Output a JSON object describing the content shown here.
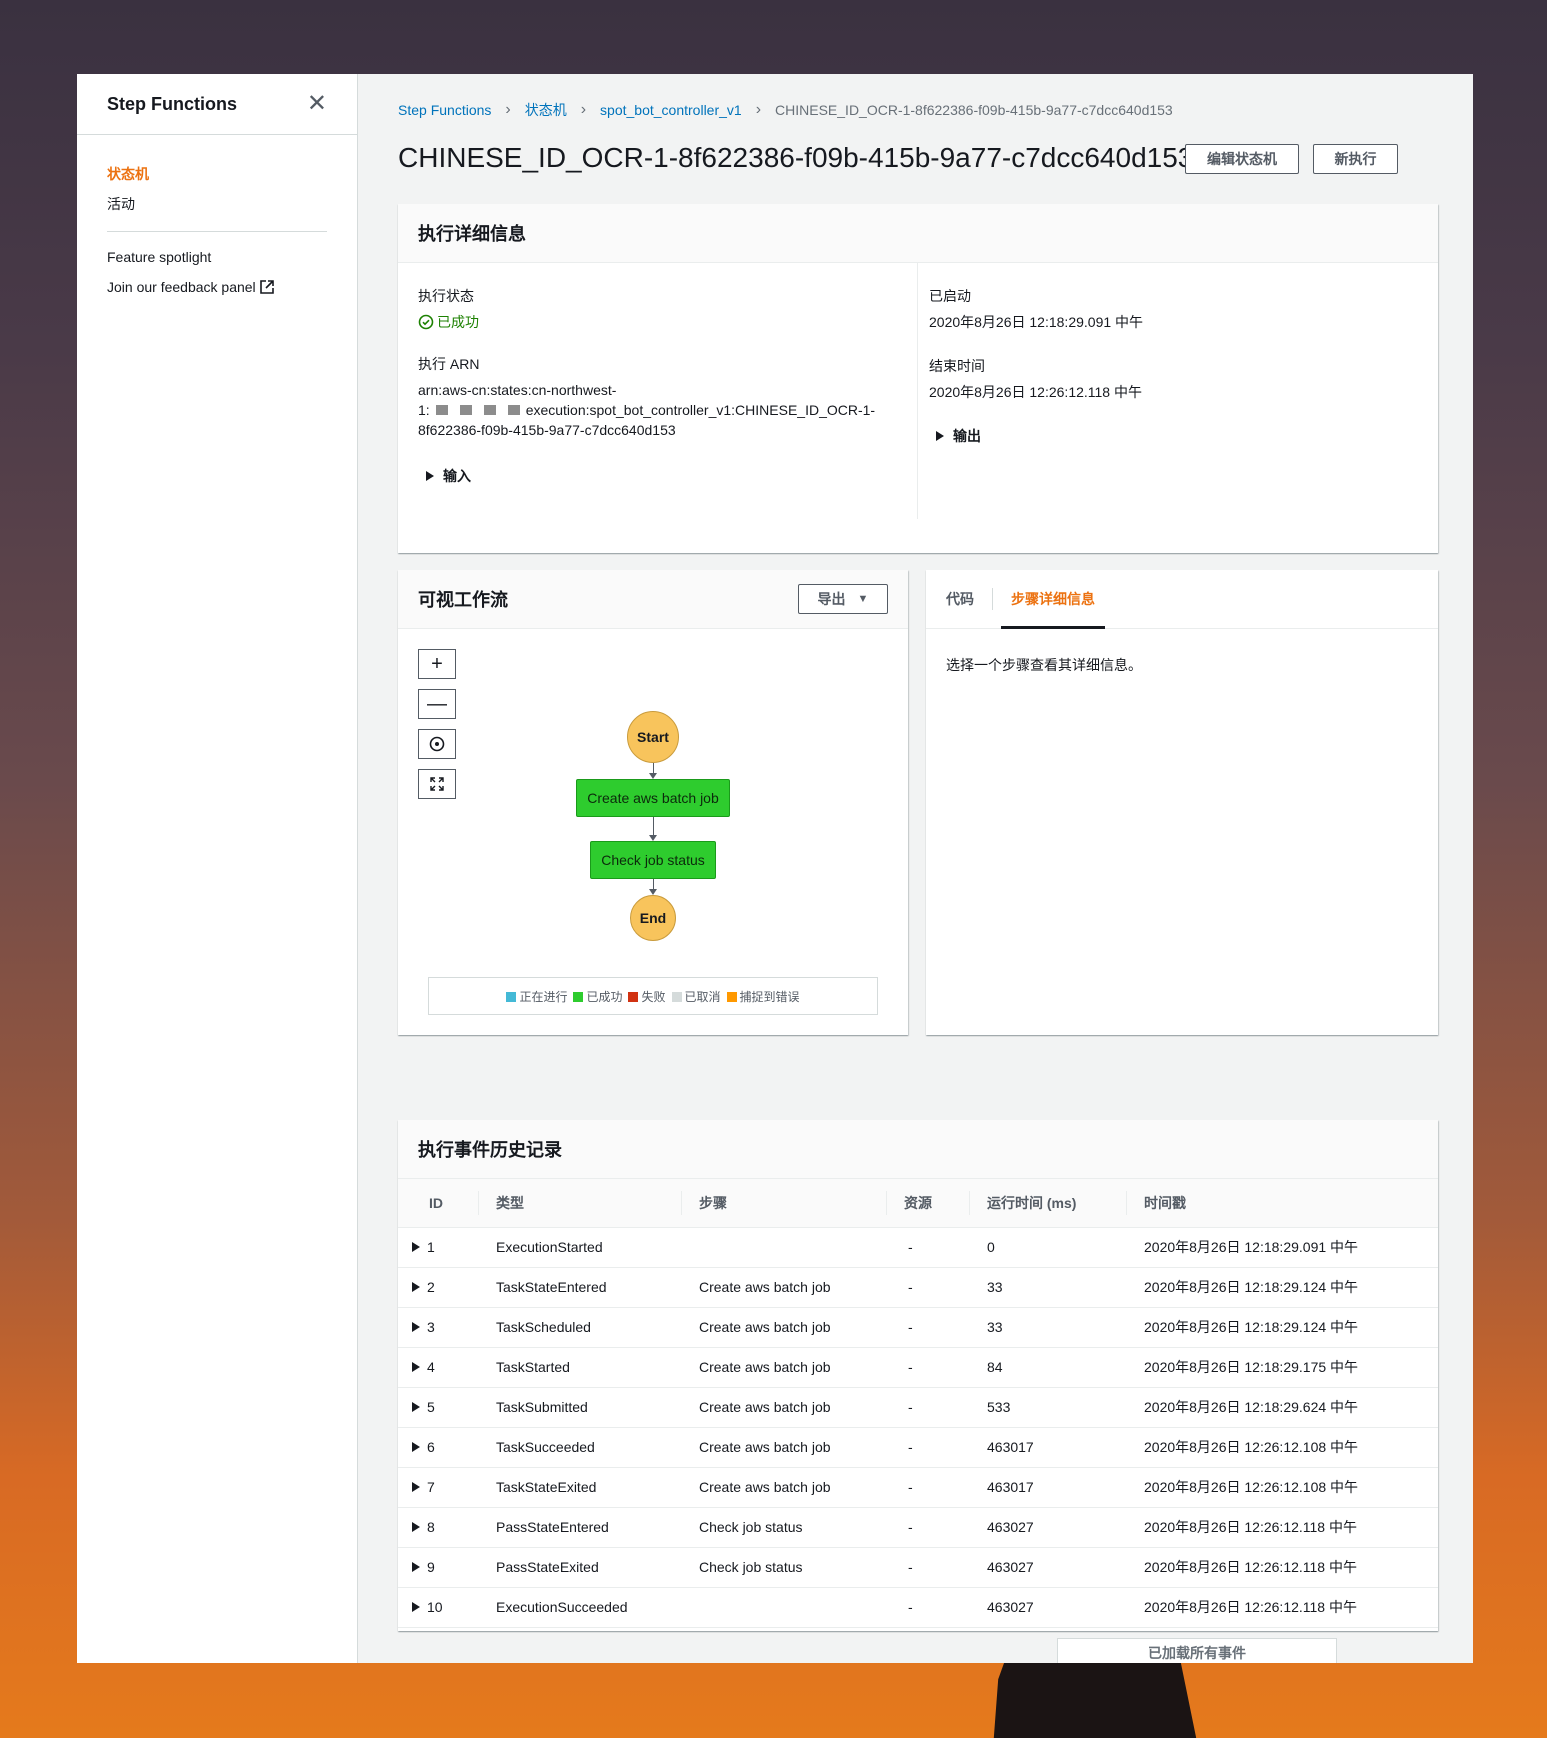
{
  "sidebar": {
    "title": "Step Functions",
    "items": [
      {
        "label": "状态机"
      },
      {
        "label": "活动"
      }
    ],
    "links": [
      {
        "label": "Feature spotlight"
      },
      {
        "label": "Join our feedback panel"
      }
    ]
  },
  "breadcrumb": [
    "Step Functions",
    "状态机",
    "spot_bot_controller_v1",
    "CHINESE_ID_OCR-1-8f622386-f09b-415b-9a77-c7dcc640d153"
  ],
  "page_title": "CHINESE_ID_OCR-1-8f622386-f09b-415b-9a77-c7dcc640d153",
  "buttons": {
    "edit": "编辑状态机",
    "new_exec": "新执行"
  },
  "details": {
    "title": "执行详细信息",
    "status_label": "执行状态",
    "status_value": "已成功",
    "arn_label": "执行 ARN",
    "arn_line1": "arn:aws-cn:states:cn-northwest-",
    "arn_line2_prefix": "1:",
    "arn_line2_suffix": "execution:spot_bot_controller_v1:CHINESE_ID_OCR-1-",
    "arn_line3": "8f622386-f09b-415b-9a77-c7dcc640d153",
    "input_label": "输入",
    "started_label": "已启动",
    "started_value": "2020年8月26日 12:18:29.091 中午",
    "ended_label": "结束时间",
    "ended_value": "2020年8月26日 12:26:12.118 中午",
    "output_label": "输出"
  },
  "workflow": {
    "title": "可视工作流",
    "export_label": "导出",
    "nodes": {
      "start": "Start",
      "create": "Create aws batch job",
      "check": "Check job status",
      "end": "End"
    },
    "legend": [
      {
        "label": "正在进行",
        "color": "#44b9d6"
      },
      {
        "label": "已成功",
        "color": "#2ecc2e"
      },
      {
        "label": "失败",
        "color": "#d13212"
      },
      {
        "label": "已取消",
        "color": "#d5dbdb"
      },
      {
        "label": "捕捉到错误",
        "color": "#ff9900"
      }
    ]
  },
  "step_panel": {
    "tabs": [
      "代码",
      "步骤详细信息"
    ],
    "message": "选择一个步骤查看其详细信息。"
  },
  "history": {
    "title": "执行事件历史记录",
    "columns": [
      "ID",
      "类型",
      "步骤",
      "资源",
      "运行时间 (ms)",
      "时间戳"
    ],
    "rows": [
      {
        "id": "1",
        "type": "ExecutionStarted",
        "step": "",
        "resource": "-",
        "elapsed": "0",
        "timestamp": "2020年8月26日 12:18:29.091 中午"
      },
      {
        "id": "2",
        "type": "TaskStateEntered",
        "step": "Create aws batch job",
        "resource": "-",
        "elapsed": "33",
        "timestamp": "2020年8月26日 12:18:29.124 中午"
      },
      {
        "id": "3",
        "type": "TaskScheduled",
        "step": "Create aws batch job",
        "resource": "-",
        "elapsed": "33",
        "timestamp": "2020年8月26日 12:18:29.124 中午"
      },
      {
        "id": "4",
        "type": "TaskStarted",
        "step": "Create aws batch job",
        "resource": "-",
        "elapsed": "84",
        "timestamp": "2020年8月26日 12:18:29.175 中午"
      },
      {
        "id": "5",
        "type": "TaskSubmitted",
        "step": "Create aws batch job",
        "resource": "-",
        "elapsed": "533",
        "timestamp": "2020年8月26日 12:18:29.624 中午"
      },
      {
        "id": "6",
        "type": "TaskSucceeded",
        "step": "Create aws batch job",
        "resource": "-",
        "elapsed": "463017",
        "timestamp": "2020年8月26日 12:26:12.108 中午"
      },
      {
        "id": "7",
        "type": "TaskStateExited",
        "step": "Create aws batch job",
        "resource": "-",
        "elapsed": "463017",
        "timestamp": "2020年8月26日 12:26:12.108 中午"
      },
      {
        "id": "8",
        "type": "PassStateEntered",
        "step": "Check job status",
        "resource": "-",
        "elapsed": "463027",
        "timestamp": "2020年8月26日 12:26:12.118 中午"
      },
      {
        "id": "9",
        "type": "PassStateExited",
        "step": "Check job status",
        "resource": "-",
        "elapsed": "463027",
        "timestamp": "2020年8月26日 12:26:12.118 中午"
      },
      {
        "id": "10",
        "type": "ExecutionSucceeded",
        "step": "",
        "resource": "-",
        "elapsed": "463027",
        "timestamp": "2020年8月26日 12:26:12.118 中午"
      }
    ],
    "load_all": "已加载所有事件"
  }
}
